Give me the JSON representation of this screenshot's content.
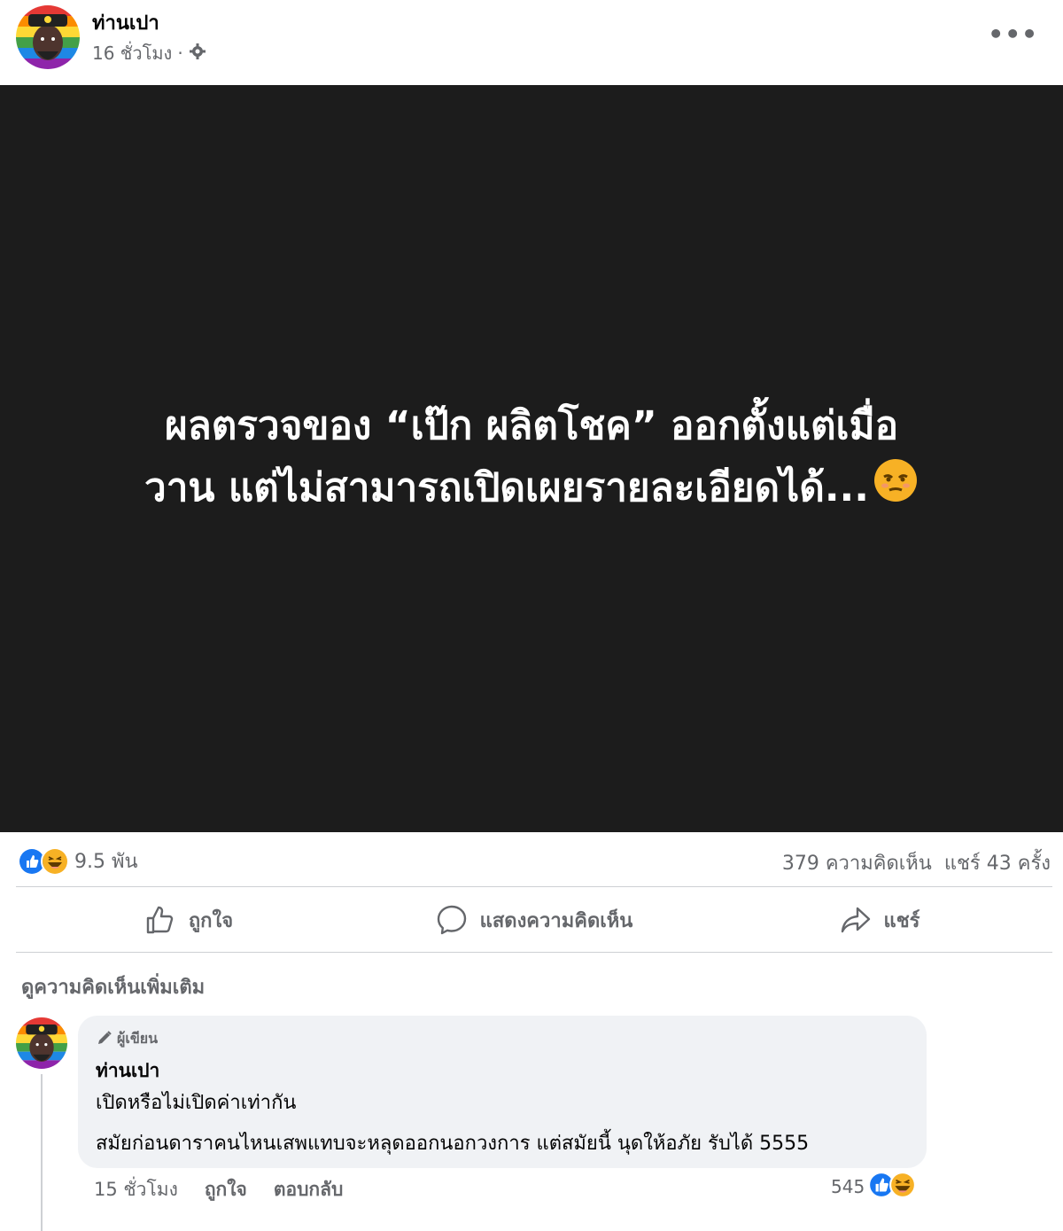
{
  "post": {
    "author": "ท่านเปา",
    "time": "16 ชั่วโมง",
    "separator": "·",
    "privacy_icon": "gear-icon",
    "more_label": "•••",
    "text_line1": "ผลตรวจของ “เป๊ก ผลิตโชค” ออกตั้งแต่เมื่อ",
    "text_line2": "วาน แต่ไม่สามารถเปิดเผยรายละเอียดได้...",
    "text_emoji": "unamused-face-emoji"
  },
  "stats": {
    "reaction_icons": [
      "like-icon",
      "haha-icon"
    ],
    "reaction_count": "9.5 พัน",
    "comments": "379 ความคิดเห็น",
    "shares": "แชร์ 43 ครั้ง"
  },
  "actions": {
    "like": "ถูกใจ",
    "comment": "แสดงความคิดเห็น",
    "share": "แชร์"
  },
  "view_more_comments": "ดูความคิดเห็นเพิ่มเติม",
  "comment": {
    "badge": "ผู้เขียน",
    "author": "ท่านเปา",
    "line1": "เปิดหรือไม่เปิดค่าเท่ากัน",
    "line2": "สมัยก่อนดาราคนไหนเสพแทบจะหลุดออกนอกวงการ แต่สมัยนี้ นุดให้อภัย รับได้ 5555",
    "time": "15 ชั่วโมง",
    "like": "ถูกใจ",
    "reply": "ตอบกลับ",
    "reaction_count": "545"
  },
  "colors": {
    "like_blue": "#1877f2",
    "haha_yellow": "#f7b125",
    "media_bg": "#1c1c1c",
    "bubble_bg": "#f0f2f5",
    "secondary_text": "#65676b"
  }
}
